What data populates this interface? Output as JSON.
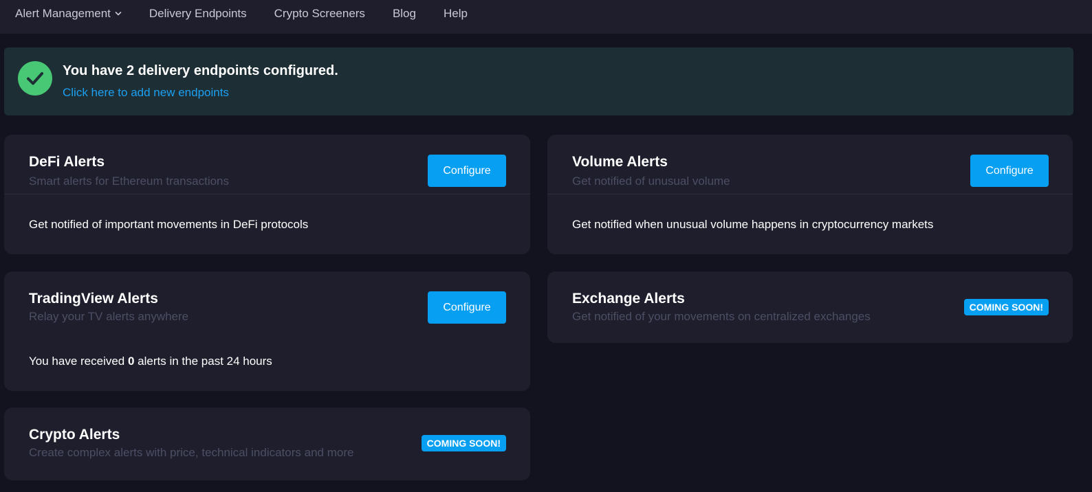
{
  "nav": {
    "items": [
      {
        "label": "Alert Management"
      },
      {
        "label": "Delivery Endpoints"
      },
      {
        "label": "Crypto Screeners"
      },
      {
        "label": "Blog"
      },
      {
        "label": "Help"
      }
    ]
  },
  "banner": {
    "title": "You have 2 delivery endpoints configured.",
    "link": "Click here to add new endpoints"
  },
  "cards": {
    "defi": {
      "title": "DeFi Alerts",
      "subtitle": "Smart alerts for Ethereum transactions",
      "button": "Configure",
      "body": "Get notified of important movements in DeFi protocols"
    },
    "volume": {
      "title": "Volume Alerts",
      "subtitle": "Get notified of unusual volume",
      "button": "Configure",
      "body": "Get notified when unusual volume happens in cryptocurrency markets"
    },
    "tradingview": {
      "title": "TradingView Alerts",
      "subtitle": "Relay your TV alerts anywhere",
      "button": "Configure",
      "body_prefix": "You have received ",
      "alert_count": "0",
      "body_suffix": " alerts in the past 24 hours"
    },
    "exchange": {
      "title": "Exchange Alerts",
      "subtitle": "Get notified of your movements on centralized exchanges",
      "badge": "COMING SOON!"
    },
    "crypto": {
      "title": "Crypto Alerts",
      "subtitle": "Create complex alerts with price, technical indicators and more",
      "badge": "COMING SOON!"
    }
  },
  "colors": {
    "background": "#13131f",
    "surface": "#1e1e2c",
    "accent": "#079ff2",
    "success": "#48c774",
    "link": "#1ba0f2"
  },
  "icons": {
    "nav_dropdown": "chevron-down-icon",
    "banner_status": "check-circle-icon"
  }
}
